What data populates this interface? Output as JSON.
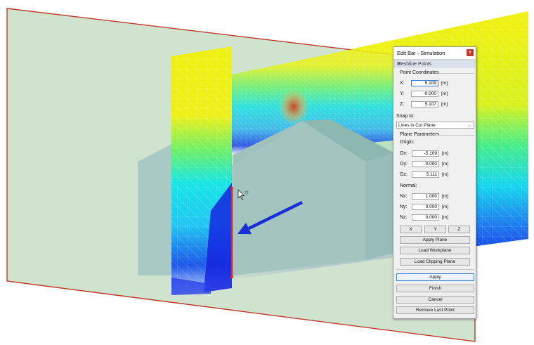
{
  "dialog": {
    "title": "Edit Bar - Simulation",
    "close_glyph": "x",
    "section_header": "Meshline Points",
    "point_coordinates": {
      "heading": "Point Coordinates",
      "rows": [
        {
          "label": "X:",
          "value": "5.109",
          "unit": "[m]"
        },
        {
          "label": "Y:",
          "value": "-0.000",
          "unit": "[m]"
        },
        {
          "label": "Z:",
          "value": "5.107",
          "unit": "[m]"
        }
      ]
    },
    "snap_to": {
      "label": "Snap to:",
      "selected": "Lines in Cut Plane"
    },
    "plane_parameters": {
      "heading": "Plane Parameters",
      "origin_label": "Origin:",
      "origin": [
        {
          "label": "Ox:",
          "value": "-5.109",
          "unit": "[m]"
        },
        {
          "label": "Oy:",
          "value": "-0.000",
          "unit": "[m]"
        },
        {
          "label": "Oz:",
          "value": "5.111",
          "unit": "[m]"
        }
      ],
      "normal_label": "Normal:",
      "normal": [
        {
          "label": "Nx:",
          "value": "1.000",
          "unit": "[m]"
        },
        {
          "label": "Ny:",
          "value": "0.000",
          "unit": "[m]"
        },
        {
          "label": "Nz:",
          "value": "0.000",
          "unit": "[m]"
        }
      ]
    },
    "axis_buttons": [
      "X",
      "Y",
      "Z"
    ],
    "apply_plane": "Apply Plane",
    "load_workplane": "Load Workplane",
    "load_clipping_plane": "Load Clipping Plane",
    "apply": "Apply",
    "finish": "Finish",
    "cancel": "Cancel",
    "remove_last_point": "Remove Last Point"
  },
  "colors": {
    "cut_plane_fill": "#c9dfc8",
    "cut_plane_edge": "#c0392b",
    "building": "#a8c9c4",
    "arrow": "#1a2fd8",
    "meshline": "#e0241b",
    "accent": "#3c7fd6"
  },
  "icons": {
    "cursor": "arrow-cursor-icon",
    "close": "close-icon",
    "dropdown": "chevron-down-icon"
  }
}
